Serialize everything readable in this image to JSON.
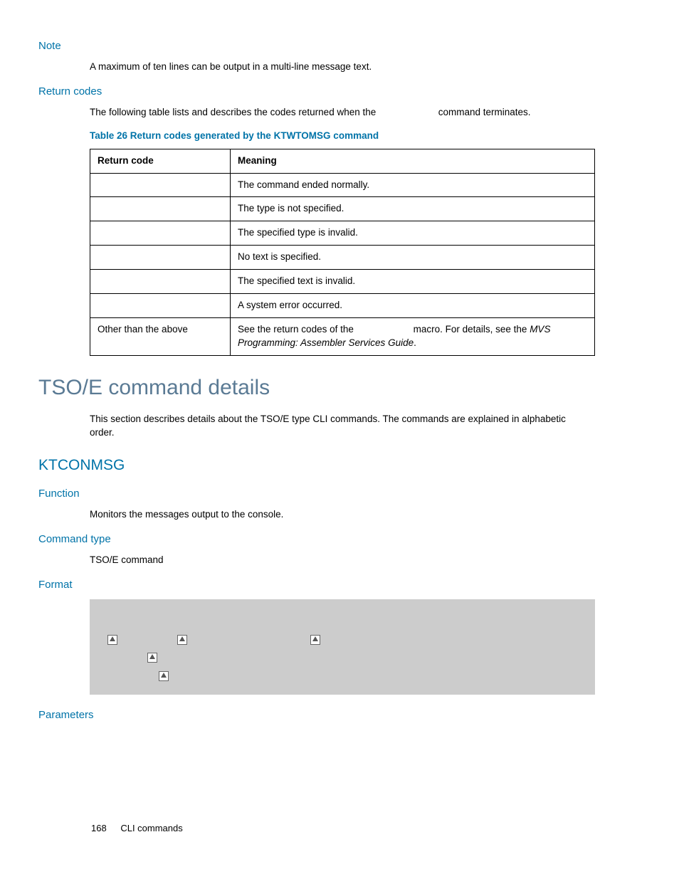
{
  "note": {
    "heading": "Note",
    "text": "A maximum of ten lines can be output in a multi-line message text."
  },
  "returnCodes": {
    "heading": "Return codes",
    "intro_a": "The following table lists and describes the codes returned when the ",
    "intro_b": " command terminates.",
    "caption": "Table 26 Return codes generated by the KTWTOMSG command",
    "th_code": "Return code",
    "th_meaning": "Meaning",
    "rows": [
      {
        "code": "",
        "meaning": "The command ended normally."
      },
      {
        "code": "",
        "meaning": "The type is not specified."
      },
      {
        "code": "",
        "meaning": "The specified type is invalid."
      },
      {
        "code": "",
        "meaning": "No text is specified."
      },
      {
        "code": "",
        "meaning": "The specified text is invalid."
      },
      {
        "code": "",
        "meaning": "A system error occurred."
      }
    ],
    "last": {
      "code": "Other than the above",
      "part1": "See the return codes of the ",
      "part2": " macro. For details, see the ",
      "ref": "MVS Programming: Assembler Services Guide",
      "part3": "."
    }
  },
  "tso": {
    "heading": "TSO/E command details",
    "intro": "This section describes details about the TSO/E type CLI commands. The commands are explained in alphabetic order."
  },
  "ktconmsg": {
    "heading": "KTCONMSG",
    "function_h": "Function",
    "function_t": "Monitors the messages output to the console.",
    "cmdtype_h": "Command type",
    "cmdtype_t": "TSO/E command",
    "format_h": "Format",
    "parameters_h": "Parameters"
  },
  "footer": {
    "page": "168",
    "section": "CLI commands"
  }
}
